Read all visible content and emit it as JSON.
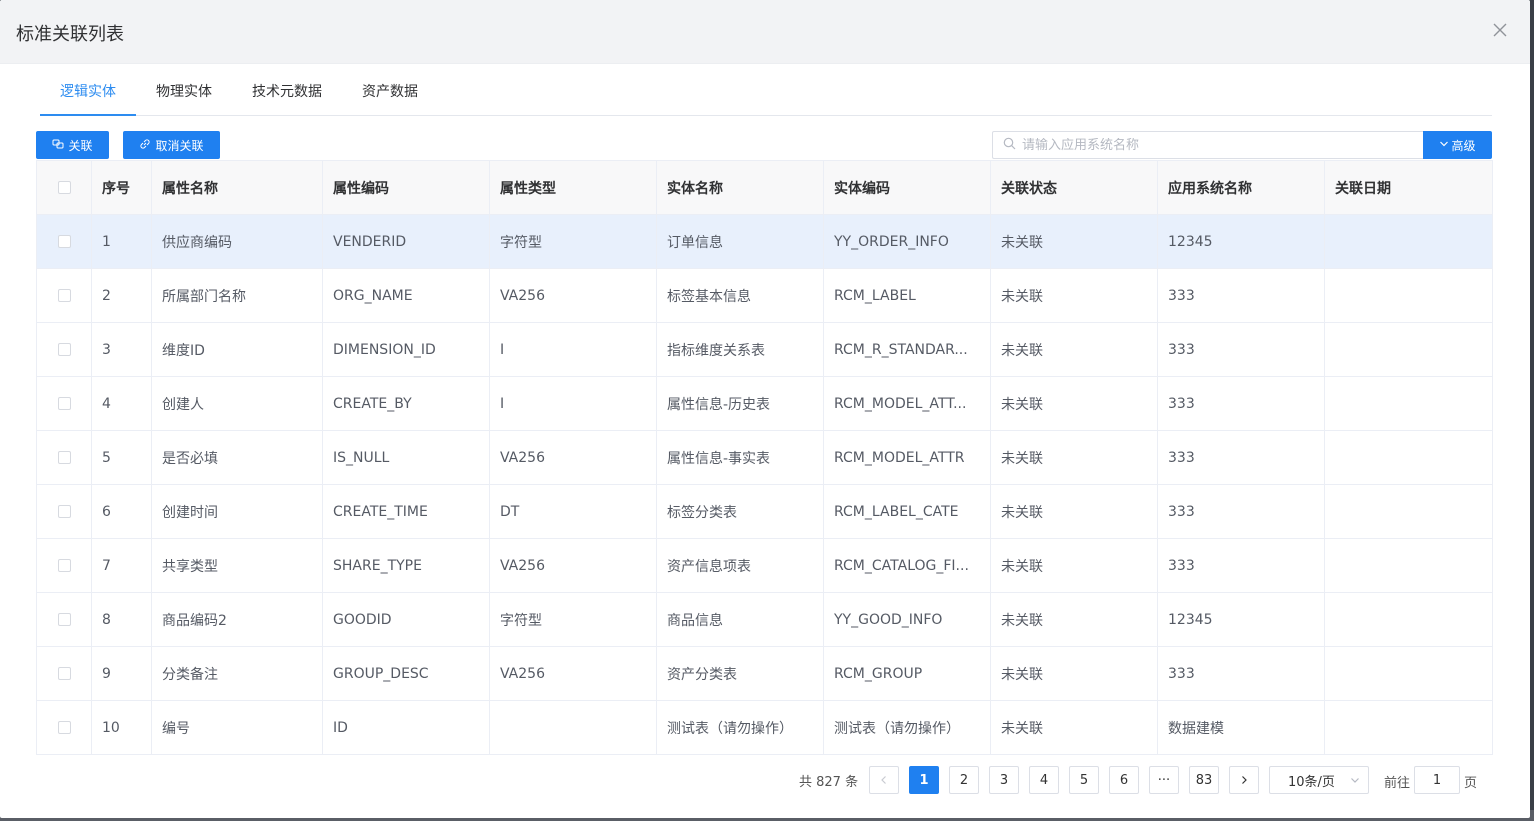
{
  "dialog": {
    "title": "标准关联列表",
    "close_icon": "close-icon"
  },
  "tabs": [
    {
      "label": "逻辑实体",
      "active": true
    },
    {
      "label": "物理实体",
      "active": false
    },
    {
      "label": "技术元数据",
      "active": false
    },
    {
      "label": "资产数据",
      "active": false
    }
  ],
  "toolbar": {
    "link_label": "关联",
    "unlink_label": "取消关联",
    "search_placeholder": "请输入应用系统名称",
    "advanced_label": "高级"
  },
  "table": {
    "columns": [
      "序号",
      "属性名称",
      "属性编码",
      "属性类型",
      "实体名称",
      "实体编码",
      "关联状态",
      "应用系统名称",
      "关联日期"
    ],
    "rows": [
      {
        "no": "1",
        "attr_name": "供应商编码",
        "attr_code": "VENDERID",
        "attr_type": "字符型",
        "entity_name": "订单信息",
        "entity_code": "YY_ORDER_INFO",
        "status": "未关联",
        "app": "12345",
        "date": ""
      },
      {
        "no": "2",
        "attr_name": "所属部门名称",
        "attr_code": "ORG_NAME",
        "attr_type": "VA256",
        "entity_name": "标签基本信息",
        "entity_code": "RCM_LABEL",
        "status": "未关联",
        "app": "333",
        "date": ""
      },
      {
        "no": "3",
        "attr_name": "维度ID",
        "attr_code": "DIMENSION_ID",
        "attr_type": "I",
        "entity_name": "指标维度关系表",
        "entity_code": "RCM_R_STANDAR...",
        "status": "未关联",
        "app": "333",
        "date": ""
      },
      {
        "no": "4",
        "attr_name": "创建人",
        "attr_code": "CREATE_BY",
        "attr_type": "I",
        "entity_name": "属性信息-历史表",
        "entity_code": "RCM_MODEL_ATT...",
        "status": "未关联",
        "app": "333",
        "date": ""
      },
      {
        "no": "5",
        "attr_name": "是否必填",
        "attr_code": "IS_NULL",
        "attr_type": "VA256",
        "entity_name": "属性信息-事实表",
        "entity_code": "RCM_MODEL_ATTR",
        "status": "未关联",
        "app": "333",
        "date": ""
      },
      {
        "no": "6",
        "attr_name": "创建时间",
        "attr_code": "CREATE_TIME",
        "attr_type": "DT",
        "entity_name": "标签分类表",
        "entity_code": "RCM_LABEL_CATE",
        "status": "未关联",
        "app": "333",
        "date": ""
      },
      {
        "no": "7",
        "attr_name": "共享类型",
        "attr_code": "SHARE_TYPE",
        "attr_type": "VA256",
        "entity_name": "资产信息项表",
        "entity_code": "RCM_CATALOG_FI...",
        "status": "未关联",
        "app": "333",
        "date": ""
      },
      {
        "no": "8",
        "attr_name": "商品编码2",
        "attr_code": "GOODID",
        "attr_type": "字符型",
        "entity_name": "商品信息",
        "entity_code": "YY_GOOD_INFO",
        "status": "未关联",
        "app": "12345",
        "date": ""
      },
      {
        "no": "9",
        "attr_name": "分类备注",
        "attr_code": "GROUP_DESC",
        "attr_type": "VA256",
        "entity_name": "资产分类表",
        "entity_code": "RCM_GROUP",
        "status": "未关联",
        "app": "333",
        "date": ""
      },
      {
        "no": "10",
        "attr_name": "编号",
        "attr_code": "ID",
        "attr_type": "",
        "entity_name": "测试表（请勿操作）",
        "entity_code": "测试表（请勿操作）",
        "status": "未关联",
        "app": "数据建模",
        "date": ""
      }
    ]
  },
  "pagination": {
    "total_text": "共 827 条",
    "pages": [
      "1",
      "2",
      "3",
      "4",
      "5",
      "6",
      "···",
      "83"
    ],
    "current": "1",
    "page_size": "10条/页",
    "goto_prefix": "前往",
    "goto_value": "1",
    "goto_suffix": "页"
  },
  "colors": {
    "primary": "#1f80f0",
    "tab_active": "#2d8cf0",
    "selected_row": "#e8f0fc"
  }
}
